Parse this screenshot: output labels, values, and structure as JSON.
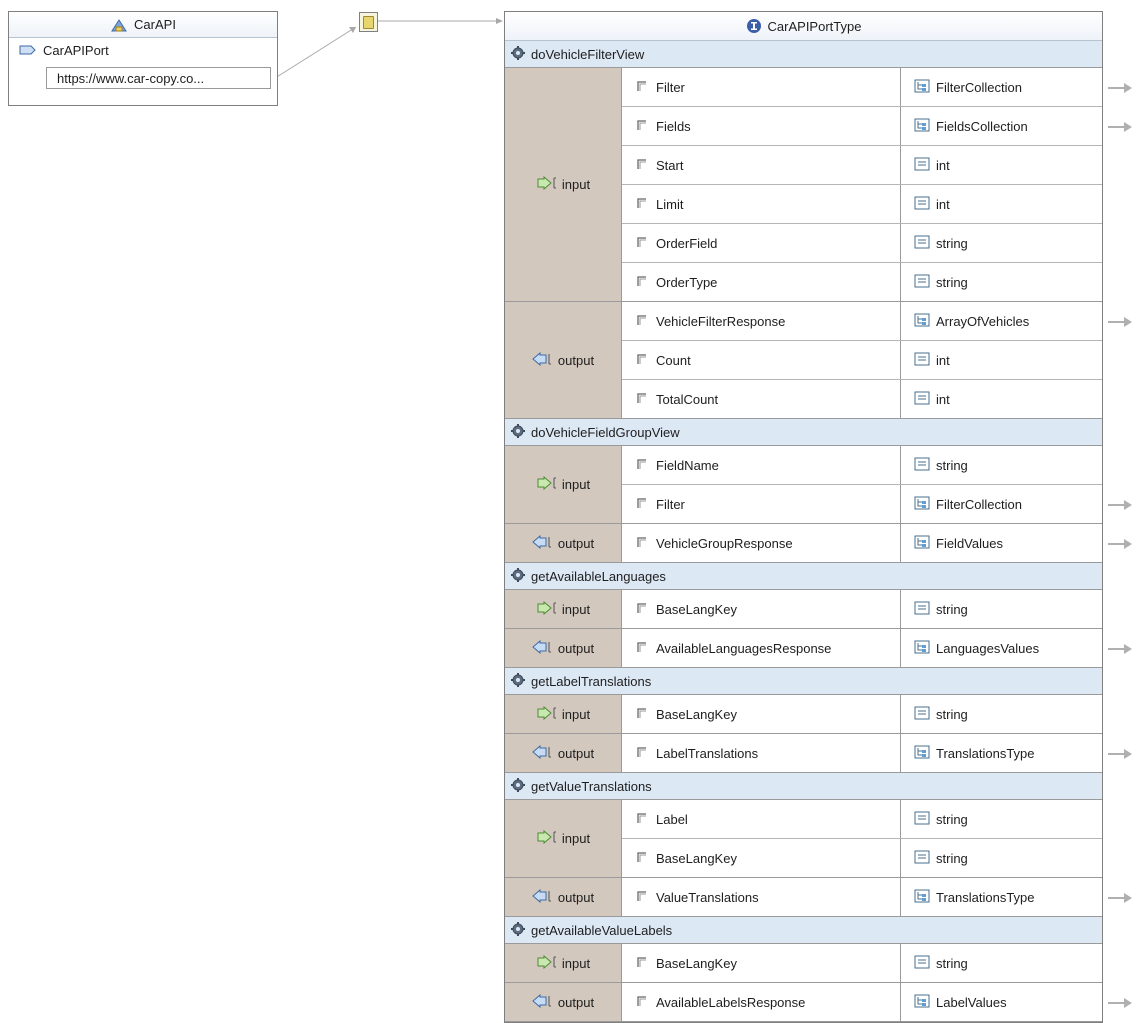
{
  "service": {
    "title": "CarAPI",
    "port_name": "CarAPIPort",
    "address": "https://www.car-copy.co..."
  },
  "port_type": {
    "title": "CarAPIPortType",
    "operations": [
      {
        "name": "doVehicleFilterView",
        "messages": [
          {
            "kind": "input",
            "label": "input",
            "parts": [
              {
                "name": "Filter",
                "type": "FilterCollection",
                "complex": true
              },
              {
                "name": "Fields",
                "type": "FieldsCollection",
                "complex": true
              },
              {
                "name": "Start",
                "type": "int",
                "complex": false
              },
              {
                "name": "Limit",
                "type": "int",
                "complex": false
              },
              {
                "name": "OrderField",
                "type": "string",
                "complex": false
              },
              {
                "name": "OrderType",
                "type": "string",
                "complex": false
              }
            ]
          },
          {
            "kind": "output",
            "label": "output",
            "parts": [
              {
                "name": "VehicleFilterResponse",
                "type": "ArrayOfVehicles",
                "complex": true
              },
              {
                "name": "Count",
                "type": "int",
                "complex": false
              },
              {
                "name": "TotalCount",
                "type": "int",
                "complex": false
              }
            ]
          }
        ]
      },
      {
        "name": "doVehicleFieldGroupView",
        "messages": [
          {
            "kind": "input",
            "label": "input",
            "parts": [
              {
                "name": "FieldName",
                "type": "string",
                "complex": false
              },
              {
                "name": "Filter",
                "type": "FilterCollection",
                "complex": true
              }
            ]
          },
          {
            "kind": "output",
            "label": "output",
            "parts": [
              {
                "name": "VehicleGroupResponse",
                "type": "FieldValues",
                "complex": true
              }
            ]
          }
        ]
      },
      {
        "name": "getAvailableLanguages",
        "messages": [
          {
            "kind": "input",
            "label": "input",
            "parts": [
              {
                "name": "BaseLangKey",
                "type": "string",
                "complex": false
              }
            ]
          },
          {
            "kind": "output",
            "label": "output",
            "parts": [
              {
                "name": "AvailableLanguagesResponse",
                "type": "LanguagesValues",
                "complex": true
              }
            ]
          }
        ]
      },
      {
        "name": "getLabelTranslations",
        "messages": [
          {
            "kind": "input",
            "label": "input",
            "parts": [
              {
                "name": "BaseLangKey",
                "type": "string",
                "complex": false
              }
            ]
          },
          {
            "kind": "output",
            "label": "output",
            "parts": [
              {
                "name": "LabelTranslations",
                "type": "TranslationsType",
                "complex": true
              }
            ]
          }
        ]
      },
      {
        "name": "getValueTranslations",
        "messages": [
          {
            "kind": "input",
            "label": "input",
            "parts": [
              {
                "name": "Label",
                "type": "string",
                "complex": false
              },
              {
                "name": "BaseLangKey",
                "type": "string",
                "complex": false
              }
            ]
          },
          {
            "kind": "output",
            "label": "output",
            "parts": [
              {
                "name": "ValueTranslations",
                "type": "TranslationsType",
                "complex": true
              }
            ]
          }
        ]
      },
      {
        "name": "getAvailableValueLabels",
        "messages": [
          {
            "kind": "input",
            "label": "input",
            "parts": [
              {
                "name": "BaseLangKey",
                "type": "string",
                "complex": false
              }
            ]
          },
          {
            "kind": "output",
            "label": "output",
            "parts": [
              {
                "name": "AvailableLabelsResponse",
                "type": "LabelValues",
                "complex": true
              }
            ]
          }
        ]
      }
    ]
  },
  "icons": {
    "service": "service-icon",
    "port": "port-icon",
    "binding": "binding-icon",
    "port_type": "interface-icon",
    "operation": "operation-gear-icon",
    "input": "input-message-icon",
    "output": "output-message-icon",
    "part": "part-icon",
    "complex_type": "complex-type-icon",
    "simple_type": "simple-type-icon",
    "type_link": "arrow-right-icon"
  },
  "colors": {
    "operation_header": "#dde8f5",
    "message_label": "#d3c8be",
    "border": "#9a9a9a",
    "connector": "#a8a8a8",
    "interface_icon": "#3a5fa8"
  }
}
